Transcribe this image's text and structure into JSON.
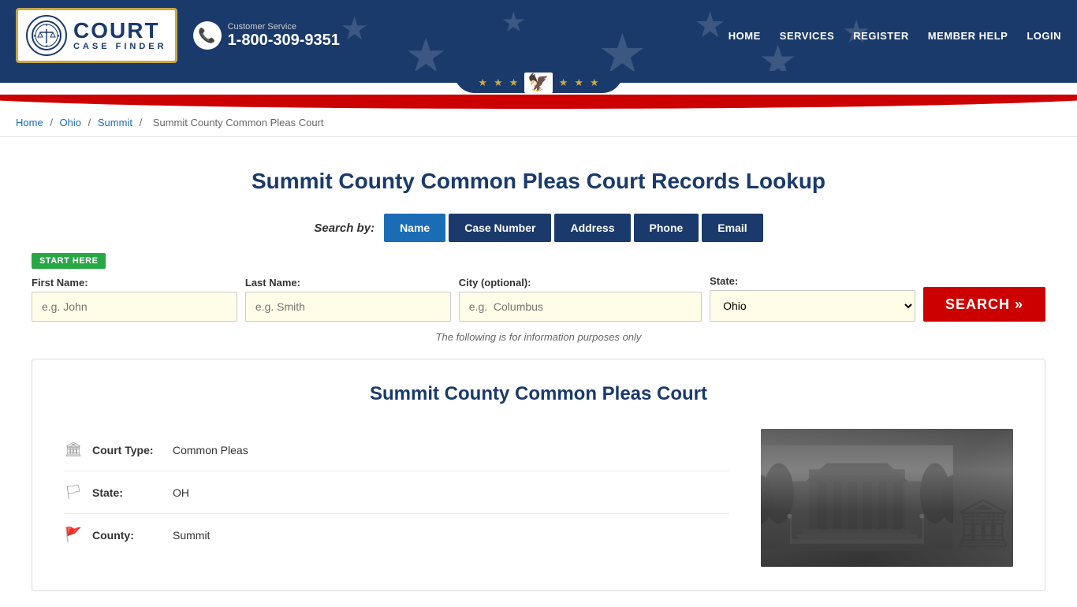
{
  "header": {
    "logo": {
      "emblem": "⚖",
      "court_text": "COURT",
      "case_finder_text": "CASE FINDER"
    },
    "phone": {
      "label": "Customer Service",
      "number": "1-800-309-9351"
    },
    "nav": {
      "items": [
        {
          "label": "HOME",
          "href": "#"
        },
        {
          "label": "SERVICES",
          "href": "#"
        },
        {
          "label": "REGISTER",
          "href": "#"
        },
        {
          "label": "MEMBER HELP",
          "href": "#"
        },
        {
          "label": "LOGIN",
          "href": "#"
        }
      ]
    }
  },
  "breadcrumb": {
    "items": [
      {
        "label": "Home",
        "href": "#"
      },
      {
        "label": "Ohio",
        "href": "#"
      },
      {
        "label": "Summit",
        "href": "#"
      },
      {
        "label": "Summit County Common Pleas Court",
        "href": null
      }
    ]
  },
  "page": {
    "title": "Summit County Common Pleas Court Records Lookup"
  },
  "search": {
    "by_label": "Search by:",
    "tabs": [
      {
        "label": "Name",
        "active": true
      },
      {
        "label": "Case Number",
        "active": false
      },
      {
        "label": "Address",
        "active": false
      },
      {
        "label": "Phone",
        "active": false
      },
      {
        "label": "Email",
        "active": false
      }
    ],
    "start_here_badge": "START HERE",
    "fields": {
      "first_name": {
        "label": "First Name:",
        "placeholder": "e.g. John"
      },
      "last_name": {
        "label": "Last Name:",
        "placeholder": "e.g. Smith"
      },
      "city": {
        "label": "City (optional):",
        "placeholder": "e.g.  Columbus"
      },
      "state": {
        "label": "State:",
        "value": "Ohio"
      }
    },
    "button_label": "SEARCH »",
    "info_note": "The following is for information purposes only"
  },
  "court_info": {
    "title": "Summit County Common Pleas Court",
    "details": [
      {
        "icon": "🏛",
        "label": "Court Type:",
        "value": "Common Pleas"
      },
      {
        "icon": "🏳",
        "label": "State:",
        "value": "OH"
      },
      {
        "icon": "🚩",
        "label": "County:",
        "value": "Summit"
      }
    ]
  }
}
